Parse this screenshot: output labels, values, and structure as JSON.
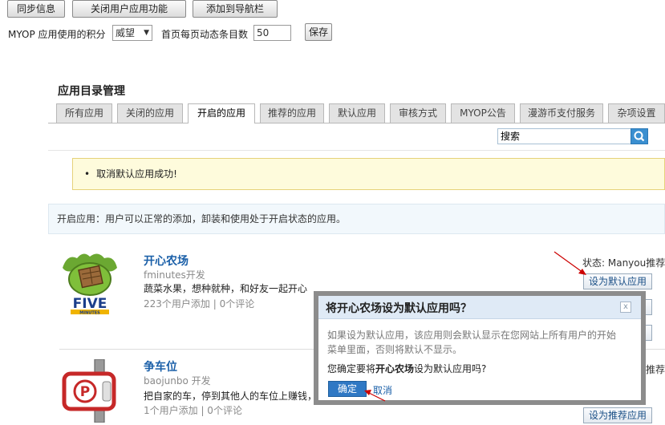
{
  "toolbar": {
    "sync_label": "同步信息",
    "close_label": "关闭用户应用功能",
    "add_nav_label": "添加到导航栏"
  },
  "settings": {
    "points_label": "MYOP 应用使用的积分",
    "points_value": "威望",
    "feed_label": "首页每页动态条目数",
    "feed_value": "50",
    "save_label": "保存"
  },
  "page_title": "应用目录管理",
  "tabs": [
    {
      "label": "所有应用"
    },
    {
      "label": "关闭的应用"
    },
    {
      "label": "开启的应用"
    },
    {
      "label": "推荐的应用"
    },
    {
      "label": "默认应用"
    },
    {
      "label": "审核方式"
    },
    {
      "label": "MYOP公告"
    },
    {
      "label": "漫游币支付服务"
    },
    {
      "label": "杂项设置"
    }
  ],
  "active_tab": "开启的应用",
  "search": {
    "value": "搜索"
  },
  "notice": "取消默认应用成功!",
  "info": "开启应用：用户可以正常的添加，卸装和使用处于开启状态的应用。",
  "apps": [
    {
      "name": "开心农场",
      "developer": "fminutes开发",
      "description": "蔬菜水果，想种就种，和好友一起开心",
      "stats": "223个用户添加 | 0个评论",
      "status": "状态: Manyou推荐",
      "default_btn": "设为默认应用"
    },
    {
      "name": "争车位",
      "developer": "baojunbo 开发",
      "description": "把自家的车，停到其他人的车位上赚钱，",
      "stats": "1个用户添加 | 0个评论",
      "status": "推荐",
      "recommend_btn": "设为推荐应用"
    }
  ],
  "dialog": {
    "title": "将开心农场设为默认应用吗？",
    "message": "如果设为默认应用，该应用则会默认显示在您网站上所有用户的开始菜单里面，否则将默认不显示。",
    "question_prefix": "您确定要将",
    "question_app": "开心农场",
    "question_suffix": "设为默认应用吗?",
    "ok_label": "确定",
    "cancel_label": "取消",
    "close_symbol": "x"
  },
  "colors": {
    "link": "#1a5fa8",
    "notice_bg": "#fefbdc",
    "info_bg": "#f2f8fc",
    "dialog_header": "#dfeaf6",
    "ok_button": "#2f78c4",
    "annotation_arrow": "#cc0000"
  }
}
